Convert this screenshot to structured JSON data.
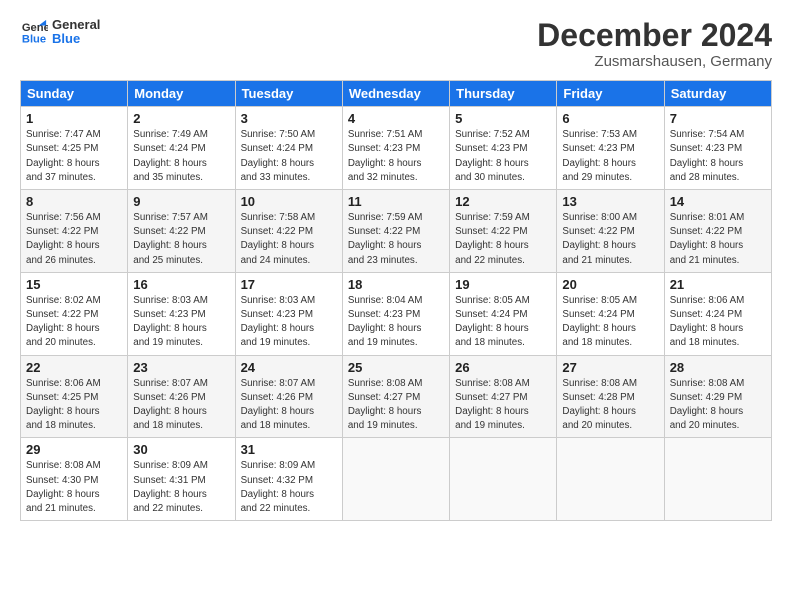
{
  "header": {
    "logo_line1": "General",
    "logo_line2": "Blue",
    "title": "December 2024",
    "location": "Zusmarshausen, Germany"
  },
  "weekdays": [
    "Sunday",
    "Monday",
    "Tuesday",
    "Wednesday",
    "Thursday",
    "Friday",
    "Saturday"
  ],
  "weeks": [
    [
      {
        "day": "1",
        "info": "Sunrise: 7:47 AM\nSunset: 4:25 PM\nDaylight: 8 hours\nand 37 minutes."
      },
      {
        "day": "2",
        "info": "Sunrise: 7:49 AM\nSunset: 4:24 PM\nDaylight: 8 hours\nand 35 minutes."
      },
      {
        "day": "3",
        "info": "Sunrise: 7:50 AM\nSunset: 4:24 PM\nDaylight: 8 hours\nand 33 minutes."
      },
      {
        "day": "4",
        "info": "Sunrise: 7:51 AM\nSunset: 4:23 PM\nDaylight: 8 hours\nand 32 minutes."
      },
      {
        "day": "5",
        "info": "Sunrise: 7:52 AM\nSunset: 4:23 PM\nDaylight: 8 hours\nand 30 minutes."
      },
      {
        "day": "6",
        "info": "Sunrise: 7:53 AM\nSunset: 4:23 PM\nDaylight: 8 hours\nand 29 minutes."
      },
      {
        "day": "7",
        "info": "Sunrise: 7:54 AM\nSunset: 4:23 PM\nDaylight: 8 hours\nand 28 minutes."
      }
    ],
    [
      {
        "day": "8",
        "info": "Sunrise: 7:56 AM\nSunset: 4:22 PM\nDaylight: 8 hours\nand 26 minutes."
      },
      {
        "day": "9",
        "info": "Sunrise: 7:57 AM\nSunset: 4:22 PM\nDaylight: 8 hours\nand 25 minutes."
      },
      {
        "day": "10",
        "info": "Sunrise: 7:58 AM\nSunset: 4:22 PM\nDaylight: 8 hours\nand 24 minutes."
      },
      {
        "day": "11",
        "info": "Sunrise: 7:59 AM\nSunset: 4:22 PM\nDaylight: 8 hours\nand 23 minutes."
      },
      {
        "day": "12",
        "info": "Sunrise: 7:59 AM\nSunset: 4:22 PM\nDaylight: 8 hours\nand 22 minutes."
      },
      {
        "day": "13",
        "info": "Sunrise: 8:00 AM\nSunset: 4:22 PM\nDaylight: 8 hours\nand 21 minutes."
      },
      {
        "day": "14",
        "info": "Sunrise: 8:01 AM\nSunset: 4:22 PM\nDaylight: 8 hours\nand 21 minutes."
      }
    ],
    [
      {
        "day": "15",
        "info": "Sunrise: 8:02 AM\nSunset: 4:22 PM\nDaylight: 8 hours\nand 20 minutes."
      },
      {
        "day": "16",
        "info": "Sunrise: 8:03 AM\nSunset: 4:23 PM\nDaylight: 8 hours\nand 19 minutes."
      },
      {
        "day": "17",
        "info": "Sunrise: 8:03 AM\nSunset: 4:23 PM\nDaylight: 8 hours\nand 19 minutes."
      },
      {
        "day": "18",
        "info": "Sunrise: 8:04 AM\nSunset: 4:23 PM\nDaylight: 8 hours\nand 19 minutes."
      },
      {
        "day": "19",
        "info": "Sunrise: 8:05 AM\nSunset: 4:24 PM\nDaylight: 8 hours\nand 18 minutes."
      },
      {
        "day": "20",
        "info": "Sunrise: 8:05 AM\nSunset: 4:24 PM\nDaylight: 8 hours\nand 18 minutes."
      },
      {
        "day": "21",
        "info": "Sunrise: 8:06 AM\nSunset: 4:24 PM\nDaylight: 8 hours\nand 18 minutes."
      }
    ],
    [
      {
        "day": "22",
        "info": "Sunrise: 8:06 AM\nSunset: 4:25 PM\nDaylight: 8 hours\nand 18 minutes."
      },
      {
        "day": "23",
        "info": "Sunrise: 8:07 AM\nSunset: 4:26 PM\nDaylight: 8 hours\nand 18 minutes."
      },
      {
        "day": "24",
        "info": "Sunrise: 8:07 AM\nSunset: 4:26 PM\nDaylight: 8 hours\nand 18 minutes."
      },
      {
        "day": "25",
        "info": "Sunrise: 8:08 AM\nSunset: 4:27 PM\nDaylight: 8 hours\nand 19 minutes."
      },
      {
        "day": "26",
        "info": "Sunrise: 8:08 AM\nSunset: 4:27 PM\nDaylight: 8 hours\nand 19 minutes."
      },
      {
        "day": "27",
        "info": "Sunrise: 8:08 AM\nSunset: 4:28 PM\nDaylight: 8 hours\nand 20 minutes."
      },
      {
        "day": "28",
        "info": "Sunrise: 8:08 AM\nSunset: 4:29 PM\nDaylight: 8 hours\nand 20 minutes."
      }
    ],
    [
      {
        "day": "29",
        "info": "Sunrise: 8:08 AM\nSunset: 4:30 PM\nDaylight: 8 hours\nand 21 minutes."
      },
      {
        "day": "30",
        "info": "Sunrise: 8:09 AM\nSunset: 4:31 PM\nDaylight: 8 hours\nand 22 minutes."
      },
      {
        "day": "31",
        "info": "Sunrise: 8:09 AM\nSunset: 4:32 PM\nDaylight: 8 hours\nand 22 minutes."
      },
      {
        "day": "",
        "info": ""
      },
      {
        "day": "",
        "info": ""
      },
      {
        "day": "",
        "info": ""
      },
      {
        "day": "",
        "info": ""
      }
    ]
  ]
}
